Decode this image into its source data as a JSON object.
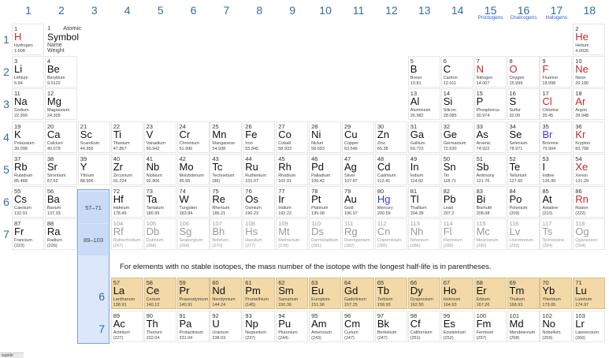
{
  "groups": [
    "1",
    "2",
    "3",
    "4",
    "5",
    "6",
    "7",
    "8",
    "9",
    "10",
    "11",
    "12",
    "13",
    "14",
    "15",
    "16",
    "17",
    "18"
  ],
  "families": [
    {
      "group": 15,
      "label": "Pnictogens"
    },
    {
      "group": 16,
      "label": "Chalcogens"
    },
    {
      "group": 17,
      "label": "Halogens"
    }
  ],
  "periods": [
    "1",
    "2",
    "3",
    "4",
    "5",
    "6",
    "7"
  ],
  "legend": {
    "number": "1",
    "symbol": "Symbol",
    "name": "Name",
    "weight": "Weight",
    "number_label": "Atomic"
  },
  "legend_sample": {
    "number": "1",
    "symbol": "H",
    "name": "Hydrogen",
    "weight": "1.008"
  },
  "lanthanide_ref": "57–71",
  "actinide_ref": "89–103",
  "fblock_labels": [
    "6",
    "7"
  ],
  "note": "For elements with no stable isotopes, the mass number of the isotope with the longest half-life is in parentheses.",
  "status_text": "sopide",
  "colors": {
    "gas": "#c62828",
    "liquid": "#2f3fd0",
    "unknown": "#9a9a9a",
    "fblock": "#f2d9a7",
    "accent": "#2e6da4"
  },
  "elements": [
    {
      "n": "1",
      "s": "H",
      "name": "Hydrogen",
      "w": "1.008",
      "st": "gas",
      "g": 1,
      "p": 1
    },
    {
      "n": "2",
      "s": "He",
      "name": "Helium",
      "w": "4.0026",
      "st": "gas",
      "g": 18,
      "p": 1
    },
    {
      "n": "3",
      "s": "Li",
      "name": "Lithium",
      "w": "6.94",
      "g": 1,
      "p": 2
    },
    {
      "n": "4",
      "s": "Be",
      "name": "Beryllium",
      "w": "9.0122",
      "g": 2,
      "p": 2
    },
    {
      "n": "5",
      "s": "B",
      "name": "Boron",
      "w": "10.81",
      "g": 13,
      "p": 2
    },
    {
      "n": "6",
      "s": "C",
      "name": "Carbon",
      "w": "12.011",
      "g": 14,
      "p": 2
    },
    {
      "n": "7",
      "s": "N",
      "name": "Nitrogen",
      "w": "14.007",
      "st": "gas",
      "g": 15,
      "p": 2
    },
    {
      "n": "8",
      "s": "O",
      "name": "Oxygen",
      "w": "15.999",
      "st": "gas",
      "g": 16,
      "p": 2
    },
    {
      "n": "9",
      "s": "F",
      "name": "Fluorine",
      "w": "18.998",
      "st": "gas",
      "g": 17,
      "p": 2
    },
    {
      "n": "10",
      "s": "Ne",
      "name": "Neon",
      "w": "20.180",
      "st": "gas",
      "g": 18,
      "p": 2
    },
    {
      "n": "11",
      "s": "Na",
      "name": "Sodium",
      "w": "22.990",
      "g": 1,
      "p": 3
    },
    {
      "n": "12",
      "s": "Mg",
      "name": "Magnesium",
      "w": "24.305",
      "g": 2,
      "p": 3
    },
    {
      "n": "13",
      "s": "Al",
      "name": "Aluminium",
      "w": "26.982",
      "g": 13,
      "p": 3
    },
    {
      "n": "14",
      "s": "Si",
      "name": "Silicon",
      "w": "28.085",
      "g": 14,
      "p": 3
    },
    {
      "n": "15",
      "s": "P",
      "name": "Phosphorus",
      "w": "30.974",
      "g": 15,
      "p": 3
    },
    {
      "n": "16",
      "s": "S",
      "name": "Sulfur",
      "w": "32.06",
      "g": 16,
      "p": 3
    },
    {
      "n": "17",
      "s": "Cl",
      "name": "Chlorine",
      "w": "35.45",
      "st": "gas",
      "g": 17,
      "p": 3
    },
    {
      "n": "18",
      "s": "Ar",
      "name": "Argon",
      "w": "39.948",
      "st": "gas",
      "g": 18,
      "p": 3
    },
    {
      "n": "19",
      "s": "K",
      "name": "Potassium",
      "w": "39.098",
      "g": 1,
      "p": 4
    },
    {
      "n": "20",
      "s": "Ca",
      "name": "Calcium",
      "w": "40.078",
      "g": 2,
      "p": 4
    },
    {
      "n": "21",
      "s": "Sc",
      "name": "Scandium",
      "w": "44.956",
      "g": 3,
      "p": 4
    },
    {
      "n": "22",
      "s": "Ti",
      "name": "Titanium",
      "w": "47.867",
      "g": 4,
      "p": 4
    },
    {
      "n": "23",
      "s": "V",
      "name": "Vanadium",
      "w": "50.942",
      "g": 5,
      "p": 4
    },
    {
      "n": "24",
      "s": "Cr",
      "name": "Chromium",
      "w": "51.996",
      "g": 6,
      "p": 4
    },
    {
      "n": "25",
      "s": "Mn",
      "name": "Manganese",
      "w": "54.938",
      "g": 7,
      "p": 4
    },
    {
      "n": "26",
      "s": "Fe",
      "name": "Iron",
      "w": "55.845",
      "g": 8,
      "p": 4
    },
    {
      "n": "27",
      "s": "Co",
      "name": "Cobalt",
      "w": "58.933",
      "g": 9,
      "p": 4
    },
    {
      "n": "28",
      "s": "Ni",
      "name": "Nickel",
      "w": "58.693",
      "g": 10,
      "p": 4
    },
    {
      "n": "29",
      "s": "Cu",
      "name": "Copper",
      "w": "63.546",
      "g": 11,
      "p": 4
    },
    {
      "n": "30",
      "s": "Zn",
      "name": "Zinc",
      "w": "65.38",
      "g": 12,
      "p": 4
    },
    {
      "n": "31",
      "s": "Ga",
      "name": "Gallium",
      "w": "69.723",
      "g": 13,
      "p": 4
    },
    {
      "n": "32",
      "s": "Ge",
      "name": "Germanium",
      "w": "72.630",
      "g": 14,
      "p": 4
    },
    {
      "n": "33",
      "s": "As",
      "name": "Arsenic",
      "w": "74.922",
      "g": 15,
      "p": 4
    },
    {
      "n": "34",
      "s": "Se",
      "name": "Selenium",
      "w": "78.971",
      "g": 16,
      "p": 4
    },
    {
      "n": "35",
      "s": "Br",
      "name": "Bromine",
      "w": "79.904",
      "st": "liquid",
      "g": 17,
      "p": 4
    },
    {
      "n": "36",
      "s": "Kr",
      "name": "Krypton",
      "w": "83.798",
      "st": "gas",
      "g": 18,
      "p": 4
    },
    {
      "n": "37",
      "s": "Rb",
      "name": "Rubidium",
      "w": "85.468",
      "g": 1,
      "p": 5
    },
    {
      "n": "38",
      "s": "Sr",
      "name": "Strontium",
      "w": "87.62",
      "g": 2,
      "p": 5
    },
    {
      "n": "39",
      "s": "Y",
      "name": "Yttrium",
      "w": "88.906",
      "g": 3,
      "p": 5
    },
    {
      "n": "40",
      "s": "Zr",
      "name": "Zirconium",
      "w": "91.224",
      "g": 4,
      "p": 5
    },
    {
      "n": "41",
      "s": "Nb",
      "name": "Niobium",
      "w": "92.906",
      "g": 5,
      "p": 5
    },
    {
      "n": "42",
      "s": "Mo",
      "name": "Molybdenum",
      "w": "95.95",
      "g": 6,
      "p": 5
    },
    {
      "n": "43",
      "s": "Tc",
      "name": "Technetium",
      "w": "(98)",
      "g": 7,
      "p": 5
    },
    {
      "n": "44",
      "s": "Ru",
      "name": "Ruthenium",
      "w": "101.07",
      "g": 8,
      "p": 5
    },
    {
      "n": "45",
      "s": "Rh",
      "name": "Rhodium",
      "w": "102.91",
      "g": 9,
      "p": 5
    },
    {
      "n": "46",
      "s": "Pd",
      "name": "Palladium",
      "w": "106.42",
      "g": 10,
      "p": 5
    },
    {
      "n": "47",
      "s": "Ag",
      "name": "Silver",
      "w": "107.87",
      "g": 11,
      "p": 5
    },
    {
      "n": "48",
      "s": "Cd",
      "name": "Cadmium",
      "w": "112.41",
      "g": 12,
      "p": 5
    },
    {
      "n": "49",
      "s": "In",
      "name": "Indium",
      "w": "114.82",
      "g": 13,
      "p": 5
    },
    {
      "n": "50",
      "s": "Sn",
      "name": "Tin",
      "w": "118.71",
      "g": 14,
      "p": 5
    },
    {
      "n": "51",
      "s": "Sb",
      "name": "Antimony",
      "w": "121.76",
      "g": 15,
      "p": 5
    },
    {
      "n": "52",
      "s": "Te",
      "name": "Tellurium",
      "w": "127.60",
      "g": 16,
      "p": 5
    },
    {
      "n": "53",
      "s": "I",
      "name": "Iodine",
      "w": "126.90",
      "g": 17,
      "p": 5
    },
    {
      "n": "54",
      "s": "Xe",
      "name": "Xenon",
      "w": "131.29",
      "st": "gas",
      "g": 18,
      "p": 5
    },
    {
      "n": "55",
      "s": "Cs",
      "name": "Caesium",
      "w": "132.91",
      "g": 1,
      "p": 6
    },
    {
      "n": "56",
      "s": "Ba",
      "name": "Barium",
      "w": "137.33",
      "g": 2,
      "p": 6
    },
    {
      "n": "72",
      "s": "Hf",
      "name": "Hafnium",
      "w": "178.49",
      "g": 4,
      "p": 6
    },
    {
      "n": "73",
      "s": "Ta",
      "name": "Tantalum",
      "w": "180.95",
      "g": 5,
      "p": 6
    },
    {
      "n": "74",
      "s": "W",
      "name": "Tungsten",
      "w": "183.84",
      "g": 6,
      "p": 6
    },
    {
      "n": "75",
      "s": "Re",
      "name": "Rhenium",
      "w": "186.21",
      "g": 7,
      "p": 6
    },
    {
      "n": "76",
      "s": "Os",
      "name": "Osmium",
      "w": "190.23",
      "g": 8,
      "p": 6
    },
    {
      "n": "77",
      "s": "Ir",
      "name": "Iridium",
      "w": "192.22",
      "g": 9,
      "p": 6
    },
    {
      "n": "78",
      "s": "Pt",
      "name": "Platinum",
      "w": "195.08",
      "g": 10,
      "p": 6
    },
    {
      "n": "79",
      "s": "Au",
      "name": "Gold",
      "w": "196.97",
      "g": 11,
      "p": 6
    },
    {
      "n": "80",
      "s": "Hg",
      "name": "Mercury",
      "w": "200.59",
      "st": "liquid",
      "g": 12,
      "p": 6
    },
    {
      "n": "81",
      "s": "Tl",
      "name": "Thallium",
      "w": "204.38",
      "g": 13,
      "p": 6
    },
    {
      "n": "82",
      "s": "Pb",
      "name": "Lead",
      "w": "207.2",
      "g": 14,
      "p": 6
    },
    {
      "n": "83",
      "s": "Bi",
      "name": "Bismuth",
      "w": "208.98",
      "g": 15,
      "p": 6
    },
    {
      "n": "84",
      "s": "Po",
      "name": "Polonium",
      "w": "(209)",
      "g": 16,
      "p": 6
    },
    {
      "n": "85",
      "s": "At",
      "name": "Astatine",
      "w": "(210)",
      "g": 17,
      "p": 6
    },
    {
      "n": "86",
      "s": "Rn",
      "name": "Radon",
      "w": "(222)",
      "st": "gas",
      "g": 18,
      "p": 6
    },
    {
      "n": "87",
      "s": "Fr",
      "name": "Francium",
      "w": "(223)",
      "g": 1,
      "p": 7
    },
    {
      "n": "88",
      "s": "Ra",
      "name": "Radium",
      "w": "(226)",
      "g": 2,
      "p": 7
    },
    {
      "n": "104",
      "s": "Rf",
      "name": "Rutherfordium",
      "w": "(267)",
      "st": "unknown",
      "g": 4,
      "p": 7
    },
    {
      "n": "105",
      "s": "Db",
      "name": "Dubnium",
      "w": "(268)",
      "st": "unknown",
      "g": 5,
      "p": 7
    },
    {
      "n": "106",
      "s": "Sg",
      "name": "Seaborgium",
      "w": "(269)",
      "st": "unknown",
      "g": 6,
      "p": 7
    },
    {
      "n": "107",
      "s": "Bh",
      "name": "Bohrium",
      "w": "(270)",
      "st": "unknown",
      "g": 7,
      "p": 7
    },
    {
      "n": "108",
      "s": "Hs",
      "name": "Hassium",
      "w": "(277)",
      "st": "unknown",
      "g": 8,
      "p": 7
    },
    {
      "n": "109",
      "s": "Mt",
      "name": "Meitnerium",
      "w": "(278)",
      "st": "unknown",
      "g": 9,
      "p": 7
    },
    {
      "n": "110",
      "s": "Ds",
      "name": "Darmstadtium",
      "w": "(281)",
      "st": "unknown",
      "g": 10,
      "p": 7
    },
    {
      "n": "111",
      "s": "Rg",
      "name": "Roentgenium",
      "w": "(282)",
      "st": "unknown",
      "g": 11,
      "p": 7
    },
    {
      "n": "112",
      "s": "Cn",
      "name": "Copernicium",
      "w": "(285)",
      "st": "unknown",
      "g": 12,
      "p": 7
    },
    {
      "n": "113",
      "s": "Nh",
      "name": "Nihonium",
      "w": "(286)",
      "st": "unknown",
      "g": 13,
      "p": 7
    },
    {
      "n": "114",
      "s": "Fl",
      "name": "Flerovium",
      "w": "(289)",
      "st": "unknown",
      "g": 14,
      "p": 7
    },
    {
      "n": "115",
      "s": "Mc",
      "name": "Moscovium",
      "w": "(290)",
      "st": "unknown",
      "g": 15,
      "p": 7
    },
    {
      "n": "116",
      "s": "Lv",
      "name": "Livermorium",
      "w": "(293)",
      "st": "unknown",
      "g": 16,
      "p": 7
    },
    {
      "n": "117",
      "s": "Ts",
      "name": "Tennessine",
      "w": "(294)",
      "st": "unknown",
      "g": 17,
      "p": 7
    },
    {
      "n": "118",
      "s": "Og",
      "name": "Oganesson",
      "w": "(294)",
      "st": "unknown",
      "g": 18,
      "p": 7
    }
  ],
  "lanthanides": [
    {
      "n": "57",
      "s": "La",
      "name": "Lanthanum",
      "w": "138.91"
    },
    {
      "n": "58",
      "s": "Ce",
      "name": "Cerium",
      "w": "140.12"
    },
    {
      "n": "59",
      "s": "Pr",
      "name": "Praseodymium",
      "w": "140.91"
    },
    {
      "n": "60",
      "s": "Nd",
      "name": "Neodymium",
      "w": "144.24"
    },
    {
      "n": "61",
      "s": "Pm",
      "name": "Promethium",
      "w": "(145)"
    },
    {
      "n": "62",
      "s": "Sm",
      "name": "Samarium",
      "w": "150.36"
    },
    {
      "n": "63",
      "s": "Eu",
      "name": "Europium",
      "w": "151.96"
    },
    {
      "n": "64",
      "s": "Gd",
      "name": "Gadolinium",
      "w": "157.25"
    },
    {
      "n": "65",
      "s": "Tb",
      "name": "Terbium",
      "w": "158.93"
    },
    {
      "n": "66",
      "s": "Dy",
      "name": "Dysprosium",
      "w": "162.50"
    },
    {
      "n": "67",
      "s": "Ho",
      "name": "Holmium",
      "w": "164.93"
    },
    {
      "n": "68",
      "s": "Er",
      "name": "Erbium",
      "w": "167.26"
    },
    {
      "n": "69",
      "s": "Tm",
      "name": "Thulium",
      "w": "168.93"
    },
    {
      "n": "70",
      "s": "Yb",
      "name": "Ytterbium",
      "w": "173.05"
    },
    {
      "n": "71",
      "s": "Lu",
      "name": "Lutetium",
      "w": "174.97"
    }
  ],
  "actinides": [
    {
      "n": "89",
      "s": "Ac",
      "name": "Actinium",
      "w": "(227)"
    },
    {
      "n": "90",
      "s": "Th",
      "name": "Thorium",
      "w": "232.04"
    },
    {
      "n": "91",
      "s": "Pa",
      "name": "Protactinium",
      "w": "231.04"
    },
    {
      "n": "92",
      "s": "U",
      "name": "Uranium",
      "w": "238.03"
    },
    {
      "n": "93",
      "s": "Np",
      "name": "Neptunium",
      "w": "(237)"
    },
    {
      "n": "94",
      "s": "Pu",
      "name": "Plutonium",
      "w": "(244)"
    },
    {
      "n": "95",
      "s": "Am",
      "name": "Americium",
      "w": "(243)"
    },
    {
      "n": "96",
      "s": "Cm",
      "name": "Curium",
      "w": "(247)"
    },
    {
      "n": "97",
      "s": "Bk",
      "name": "Berkelium",
      "w": "(247)"
    },
    {
      "n": "98",
      "s": "Cf",
      "name": "Californium",
      "w": "(251)"
    },
    {
      "n": "99",
      "s": "Es",
      "name": "Einsteinium",
      "w": "(252)"
    },
    {
      "n": "100",
      "s": "Fm",
      "name": "Fermium",
      "w": "(257)"
    },
    {
      "n": "101",
      "s": "Md",
      "name": "Mendelevium",
      "w": "(258)"
    },
    {
      "n": "102",
      "s": "No",
      "name": "Nobelium",
      "w": "(259)"
    },
    {
      "n": "103",
      "s": "Lr",
      "name": "Lawrencium",
      "w": "(266)"
    }
  ]
}
